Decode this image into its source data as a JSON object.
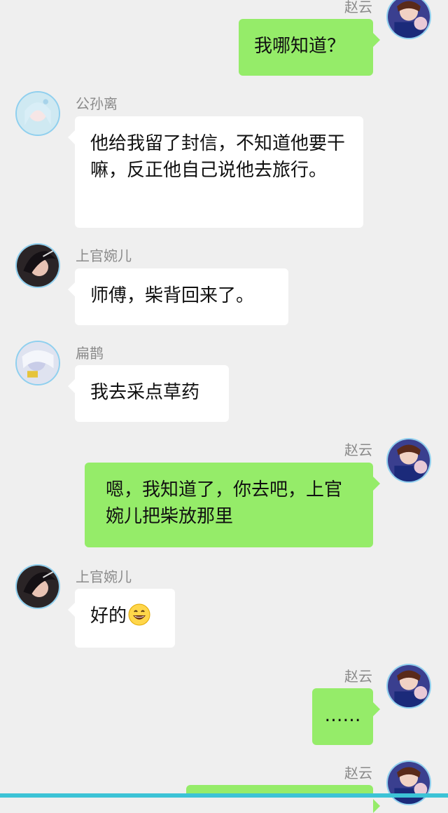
{
  "colors": {
    "background": "#efefef",
    "bubble_self": "#95ec69",
    "bubble_other": "#ffffff",
    "avatar_ring": "#8fd0ef",
    "bottom_accent": "#3cc3d6"
  },
  "messages": [
    {
      "sender": "赵云",
      "side": "right",
      "text": "我哪知道？",
      "avatar": "zhaoyun-avatar"
    },
    {
      "sender": "公孙离",
      "side": "left",
      "text": "他给我留了封信，不知道他要干嘛，反正他自己说他去旅行。",
      "avatar": "gongsunli-avatar"
    },
    {
      "sender": "上官婉儿",
      "side": "left",
      "text": "师傅，柴背回来了。",
      "avatar": "shangguan-avatar"
    },
    {
      "sender": "扁鹊",
      "side": "left",
      "text": "我去采点草药",
      "avatar": "bianque-avatar"
    },
    {
      "sender": "赵云",
      "side": "right",
      "text": "嗯，我知道了，你去吧，上官婉儿把柴放那里",
      "avatar": "zhaoyun-avatar"
    },
    {
      "sender": "上官婉儿",
      "side": "left",
      "text": "好的",
      "emoji": "grinning-face-emoji",
      "avatar": "shangguan-avatar"
    },
    {
      "sender": "赵云",
      "side": "right",
      "text": "……",
      "avatar": "zhaoyun-avatar"
    },
    {
      "sender": "赵云",
      "side": "right",
      "text": "",
      "avatar": "zhaoyun-avatar"
    }
  ]
}
